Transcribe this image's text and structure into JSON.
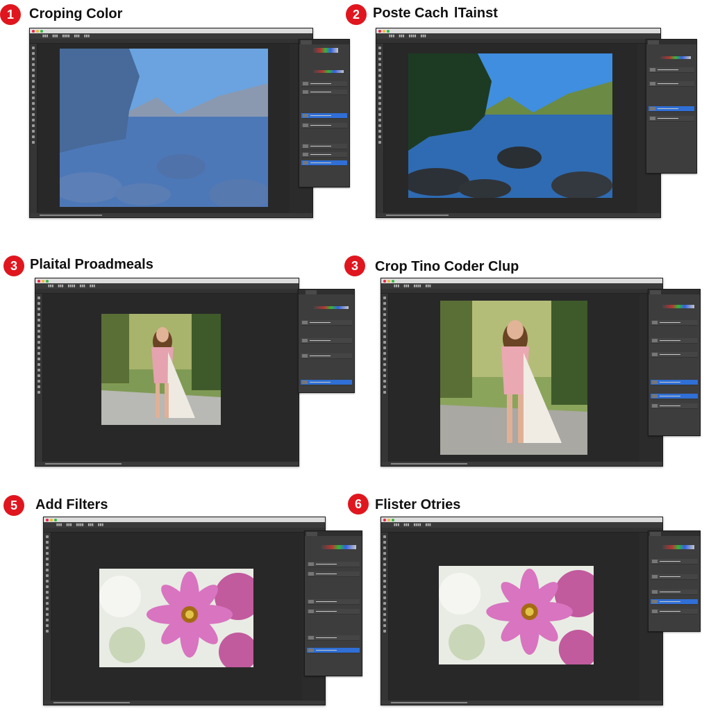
{
  "steps": [
    {
      "num": "1",
      "title": "Croping Color"
    },
    {
      "num": "2",
      "title": "Poste Cach  lTainst"
    },
    {
      "num": "3",
      "title": "Plaital Proadmeals"
    },
    {
      "num": "3",
      "title": "Crop Tino Coder Clup"
    },
    {
      "num": "5",
      "title": "Add Filters"
    },
    {
      "num": "6",
      "title": "Flister Otries"
    }
  ],
  "colors": {
    "badge": "#e0161e",
    "ui_dark": "#2b2b2b",
    "selection_blue": "#2f6fd6"
  },
  "icons": [
    "number-badge-icon",
    "tool-icon",
    "lake-photo",
    "portrait-photo",
    "flower-photo"
  ]
}
